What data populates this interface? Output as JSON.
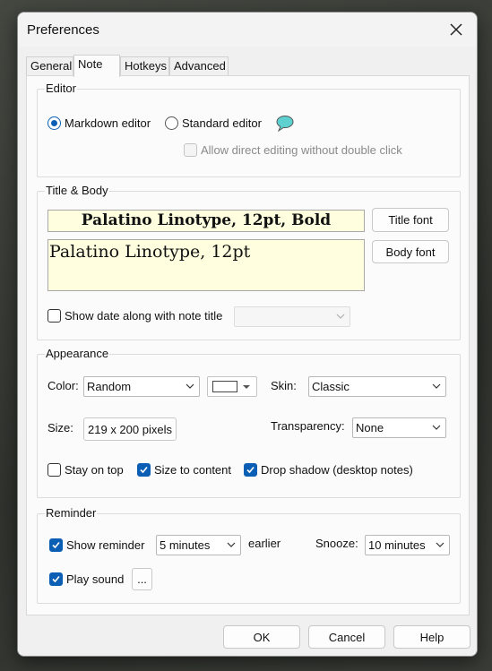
{
  "window": {
    "title": "Preferences"
  },
  "tabs": [
    "General",
    "Note",
    "Hotkeys",
    "Advanced"
  ],
  "editor": {
    "group_label": "Editor",
    "markdown_label": "Markdown editor",
    "standard_label": "Standard editor",
    "allow_direct_label": "Allow direct editing without double click",
    "selected": "markdown"
  },
  "title_body": {
    "group_label": "Title & Body",
    "title_preview": "Palatino Linotype, 12pt, Bold",
    "body_preview": "Palatino Linotype, 12pt",
    "title_font_button": "Title font",
    "body_font_button": "Body font",
    "show_date_label": "Show date along with note title",
    "date_format_value": ""
  },
  "appearance": {
    "group_label": "Appearance",
    "color_label": "Color:",
    "color_value": "Random",
    "skin_label": "Skin:",
    "skin_value": "Classic",
    "size_label": "Size:",
    "size_button": "219 x 200 pixels",
    "transparency_label": "Transparency:",
    "transparency_value": "None",
    "stay_on_top_label": "Stay on top",
    "size_to_content_label": "Size to content",
    "drop_shadow_label": "Drop shadow (desktop notes)",
    "stay_on_top": false,
    "size_to_content": true,
    "drop_shadow": true
  },
  "reminder": {
    "group_label": "Reminder",
    "show_reminder_label": "Show reminder",
    "reminder_value": "5 minutes",
    "earlier_label": "earlier",
    "snooze_label": "Snooze:",
    "snooze_value": "10 minutes",
    "play_sound_label": "Play sound",
    "sound_button": "...",
    "show_reminder": true,
    "play_sound": true
  },
  "footer": {
    "ok": "OK",
    "cancel": "Cancel",
    "help": "Help"
  },
  "colors": {
    "accent": "#0a5fb4",
    "note_bg": "#ffffdf",
    "chat_icon": "#5fd0d0"
  }
}
